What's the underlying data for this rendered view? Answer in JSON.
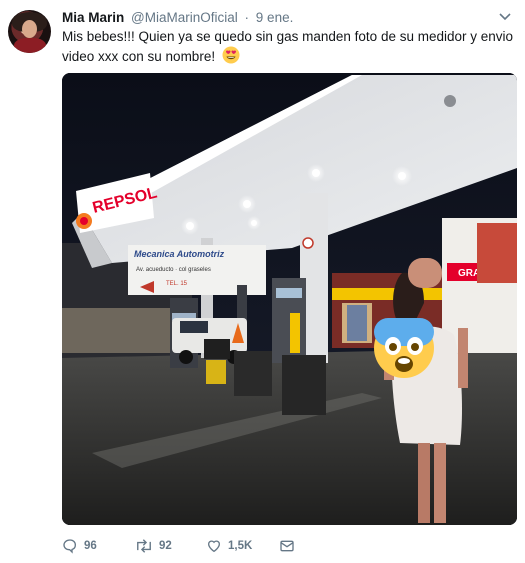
{
  "tweet": {
    "author_name": "Mia Marin",
    "handle": "@MiaMarinOficial",
    "separator": "·",
    "date": "9 ene.",
    "text": "Mis bebes!!! Quien ya se quedo sin gas manden foto de su medidor y envio video xxx con su nombre!",
    "emoji_icon": "heart-eyes-emoji-icon"
  },
  "media": {
    "sign_brand": "REPSOL",
    "sign_mecanica": "Mecanica Automotriz",
    "sign_address": "Av. acueducto · col graseles",
    "sign_tel": "TEL. 15",
    "shop_sign": "GRATIS",
    "overlay_icon": "fearful-face-emoji-icon"
  },
  "actions": {
    "replies": "96",
    "retweets": "92",
    "likes": "1,5K"
  },
  "colors": {
    "text": "#14171a",
    "secondary": "#657786",
    "repsol_orange": "#f47b20",
    "repsol_red": "#e4002b"
  }
}
